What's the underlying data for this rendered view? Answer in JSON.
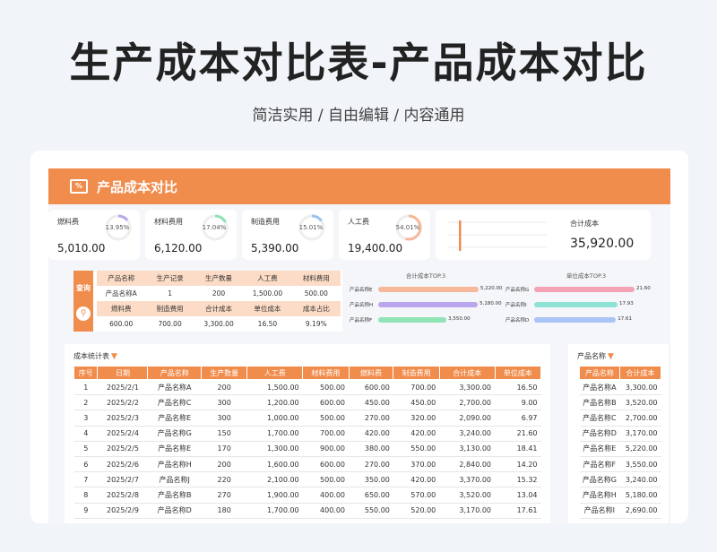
{
  "hero": {
    "title": "生产成本对比表-产品成本对比",
    "subtitle": "简洁实用 / 自由编辑 / 内容通用"
  },
  "banner": {
    "icon": "percent-chart-icon",
    "title": "产品成本对比"
  },
  "kpis": [
    {
      "label": "燃料费",
      "value": "5,010.00",
      "pct_label": "13.95%",
      "pct": 13.95,
      "color": "#b9a6ec"
    },
    {
      "label": "材料费用",
      "value": "6,120.00",
      "pct_label": "17.04%",
      "pct": 17.04,
      "color": "#8fe3b5"
    },
    {
      "label": "制造费用",
      "value": "5,390.00",
      "pct_label": "15.01%",
      "pct": 15.01,
      "color": "#9cc3f0"
    },
    {
      "label": "人工费",
      "value": "19,400.00",
      "pct_label": "54.01%",
      "pct": 54.01,
      "color": "#f7b89a"
    }
  ],
  "total": {
    "label": "合计成本",
    "value": "35,920.00"
  },
  "query": {
    "side_label": "查询",
    "search_icon": "search-icon",
    "row1_headers": [
      "产品名称",
      "生产记录",
      "生产数量",
      "人工费",
      "材料费用"
    ],
    "row1_values": [
      "产品名称A",
      "1",
      "200",
      "1,500.00",
      "500.00"
    ],
    "row2_headers": [
      "燃料费",
      "制造费用",
      "合计成本",
      "单位成本",
      "成本占比"
    ],
    "row2_values": [
      "600.00",
      "700.00",
      "3,300.00",
      "16.50",
      "9.19%"
    ]
  },
  "top3_total": {
    "title": "合计成本TOP.3",
    "items": [
      {
        "name": "产品名称E",
        "value": "5,220.00",
        "num": 5220,
        "color": "#f7b89a"
      },
      {
        "name": "产品名称H",
        "value": "5,180.00",
        "num": 5180,
        "color": "#b9a6ec"
      },
      {
        "name": "产品名称F",
        "value": "3,550.00",
        "num": 3550,
        "color": "#8fe3b5"
      }
    ]
  },
  "top3_unit": {
    "title": "单位成本TOP.3",
    "items": [
      {
        "name": "产品名称G",
        "value": "21.60",
        "num": 21.6,
        "color": "#f4a3b5"
      },
      {
        "name": "产品名称I",
        "value": "17.93",
        "num": 17.93,
        "color": "#8fe3d5"
      },
      {
        "name": "产品名称D",
        "value": "17.61",
        "num": 17.61,
        "color": "#a9c4f5"
      }
    ]
  },
  "main_table": {
    "title": "成本统计表",
    "headers": [
      "序号",
      "日期",
      "产品名称",
      "生产数量",
      "人工费",
      "材料费用",
      "燃料费",
      "制造费用",
      "合计成本",
      "单位成本"
    ],
    "rows": [
      [
        "1",
        "2025/2/1",
        "产品名称A",
        "200",
        "1,500.00",
        "500.00",
        "600.00",
        "700.00",
        "3,300.00",
        "16.50"
      ],
      [
        "2",
        "2025/2/2",
        "产品名称C",
        "300",
        "1,200.00",
        "600.00",
        "450.00",
        "450.00",
        "2,700.00",
        "9.00"
      ],
      [
        "3",
        "2025/2/3",
        "产品名称E",
        "300",
        "1,000.00",
        "500.00",
        "270.00",
        "320.00",
        "2,090.00",
        "6.97"
      ],
      [
        "4",
        "2025/2/4",
        "产品名称G",
        "150",
        "1,700.00",
        "700.00",
        "420.00",
        "420.00",
        "3,240.00",
        "21.60"
      ],
      [
        "5",
        "2025/2/5",
        "产品名称E",
        "170",
        "1,300.00",
        "900.00",
        "380.00",
        "550.00",
        "3,130.00",
        "18.41"
      ],
      [
        "6",
        "2025/2/6",
        "产品名称H",
        "200",
        "1,600.00",
        "600.00",
        "270.00",
        "370.00",
        "2,840.00",
        "14.20"
      ],
      [
        "7",
        "2025/2/7",
        "产品名称J",
        "220",
        "2,100.00",
        "500.00",
        "350.00",
        "420.00",
        "3,370.00",
        "15.32"
      ],
      [
        "8",
        "2025/2/8",
        "产品名称B",
        "270",
        "1,900.00",
        "400.00",
        "650.00",
        "570.00",
        "3,520.00",
        "13.04"
      ],
      [
        "9",
        "2025/2/9",
        "产品名称D",
        "180",
        "1,700.00",
        "400.00",
        "550.00",
        "520.00",
        "3,170.00",
        "17.61"
      ]
    ]
  },
  "side_table": {
    "title": "产品名称",
    "headers": [
      "产品名称",
      "合计成本"
    ],
    "rows": [
      [
        "产品名称A",
        "3,300.00"
      ],
      [
        "产品名称B",
        "3,520.00"
      ],
      [
        "产品名称C",
        "2,700.00"
      ],
      [
        "产品名称D",
        "3,170.00"
      ],
      [
        "产品名称E",
        "5,220.00"
      ],
      [
        "产品名称F",
        "3,550.00"
      ],
      [
        "产品名称G",
        "3,240.00"
      ],
      [
        "产品名称H",
        "5,180.00"
      ],
      [
        "产品名称I",
        "2,690.00"
      ]
    ]
  }
}
